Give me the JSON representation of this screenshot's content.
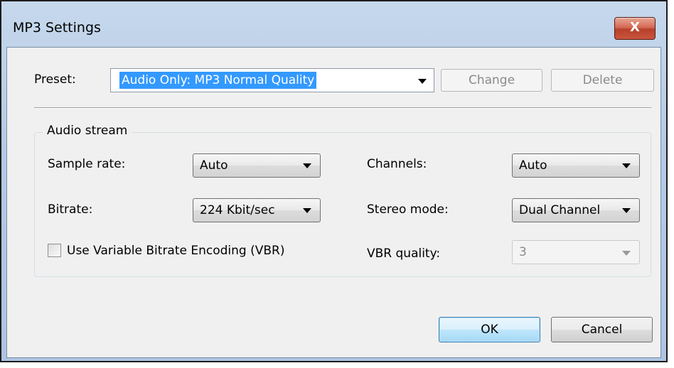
{
  "window": {
    "title": "MP3 Settings",
    "close_glyph": "X"
  },
  "preset": {
    "label": "Preset:",
    "value": "Audio Only: MP3 Normal Quality",
    "change_label": "Change",
    "delete_label": "Delete"
  },
  "audio_stream": {
    "legend": "Audio stream",
    "sample_rate_label": "Sample rate:",
    "sample_rate_value": "Auto",
    "bitrate_label": "Bitrate:",
    "bitrate_value": "224 Kbit/sec",
    "channels_label": "Channels:",
    "channels_value": "Auto",
    "stereo_mode_label": "Stereo mode:",
    "stereo_mode_value": "Dual Channel",
    "vbr_checkbox_label": "Use Variable Bitrate Encoding (VBR)",
    "vbr_checked": false,
    "vbr_quality_label": "VBR quality:",
    "vbr_quality_value": "3"
  },
  "footer": {
    "ok_label": "OK",
    "cancel_label": "Cancel"
  },
  "colors": {
    "selection": "#3399ff",
    "title_bar": "#b9cfe8",
    "close_button": "#c9553d"
  }
}
